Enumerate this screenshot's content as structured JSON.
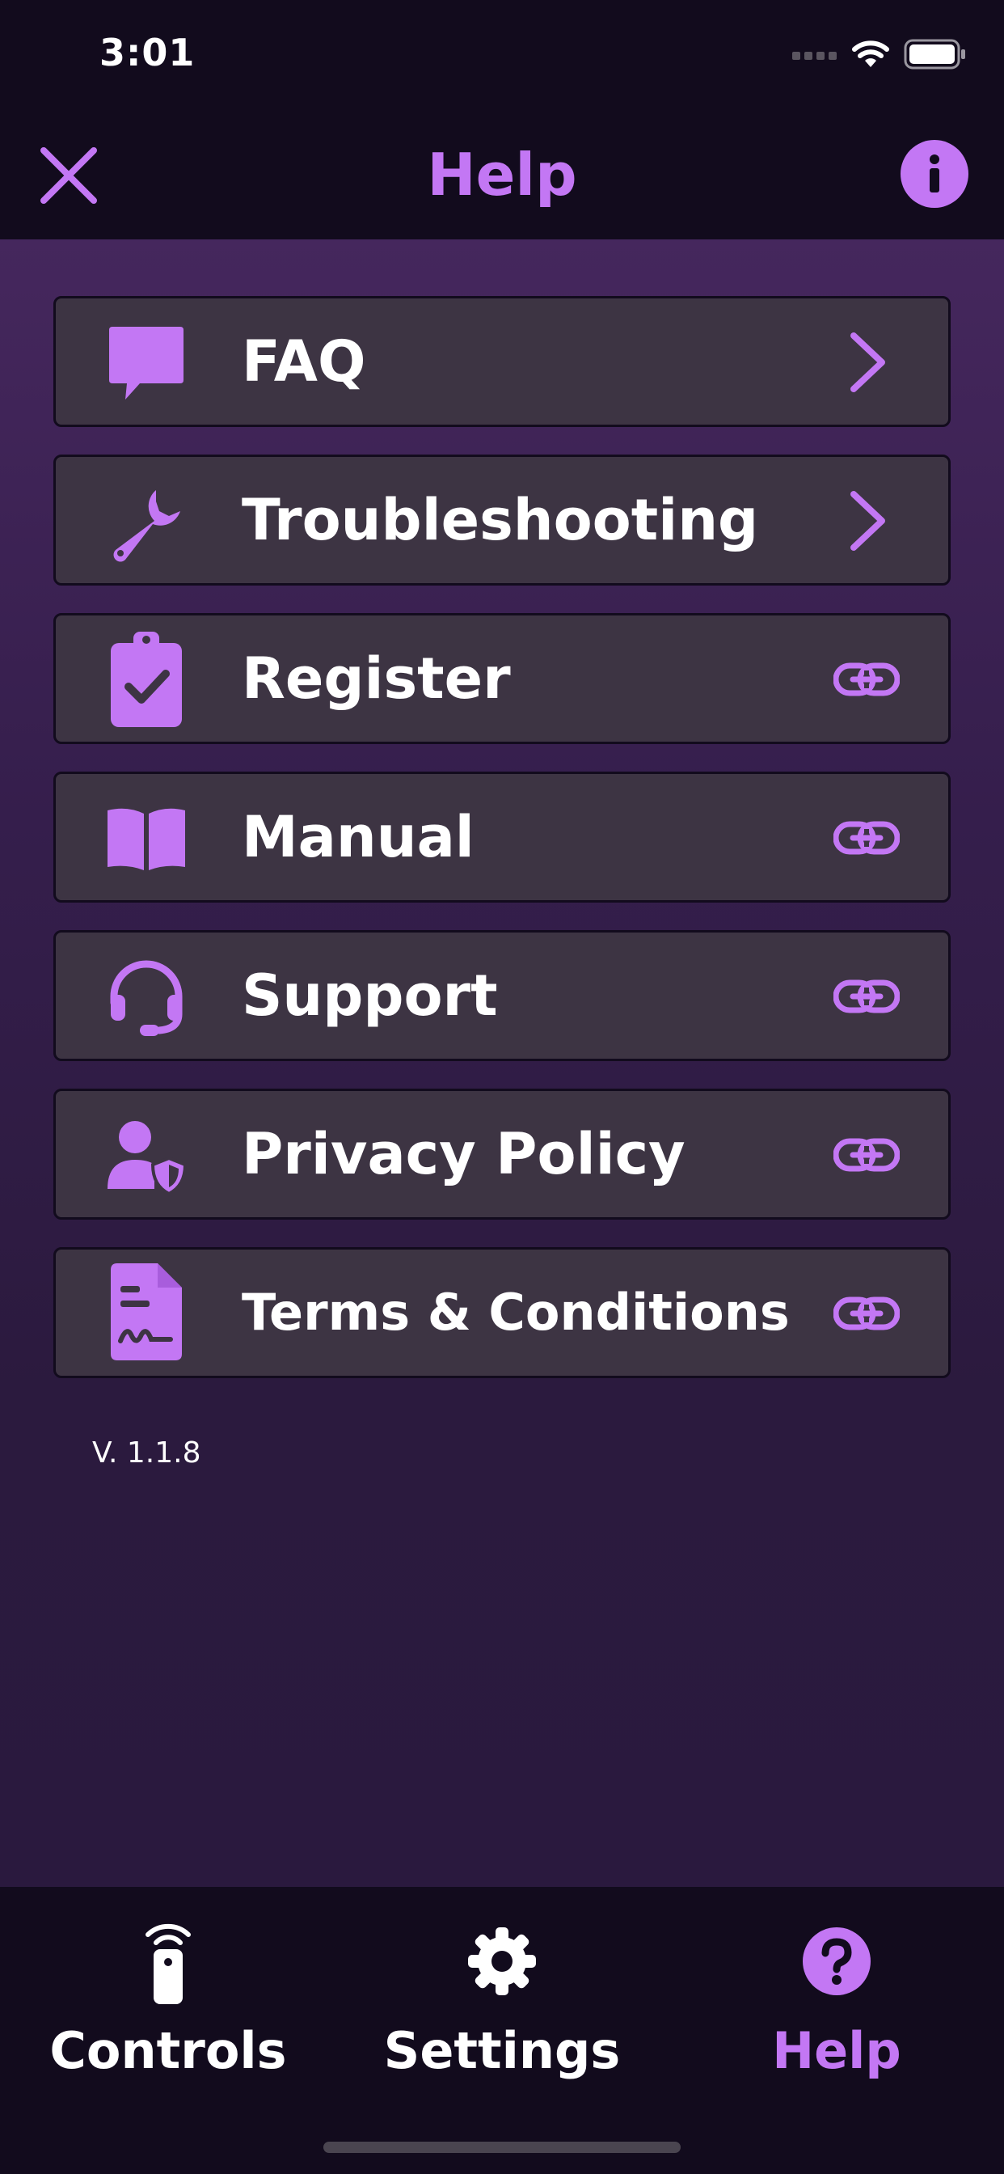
{
  "status_bar": {
    "time": "3:01"
  },
  "nav": {
    "title": "Help"
  },
  "menu": [
    {
      "label": "FAQ",
      "icon": "chat-bubble-icon",
      "trailing": "chevron-right-icon"
    },
    {
      "label": "Troubleshooting",
      "icon": "wrench-icon",
      "trailing": "chevron-right-icon"
    },
    {
      "label": "Register",
      "icon": "clipboard-check-icon",
      "trailing": "link-icon"
    },
    {
      "label": "Manual",
      "icon": "book-icon",
      "trailing": "link-icon"
    },
    {
      "label": "Support",
      "icon": "headset-icon",
      "trailing": "link-icon"
    },
    {
      "label": "Privacy Policy",
      "icon": "user-shield-icon",
      "trailing": "link-icon"
    },
    {
      "label": "Terms & Conditions",
      "icon": "signed-document-icon",
      "trailing": "link-icon"
    }
  ],
  "version": "V. 1.1.8",
  "tabs": [
    {
      "label": "Controls",
      "icon": "remote-icon",
      "active": false
    },
    {
      "label": "Settings",
      "icon": "gear-icon",
      "active": false
    },
    {
      "label": "Help",
      "icon": "question-circle-icon",
      "active": true
    }
  ],
  "colors": {
    "accent": "#c377f4",
    "background": "#120b1d",
    "card": "#3d3443"
  }
}
